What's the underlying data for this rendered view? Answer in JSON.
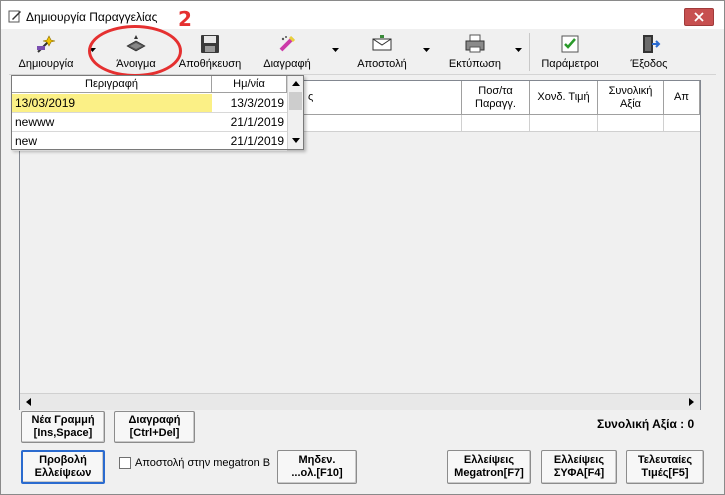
{
  "window": {
    "title": "Δημιουργία Παραγγελίας",
    "annotation_number": "2",
    "annotation_color": "#e53030"
  },
  "toolbar": {
    "create_label": "Δημιουργία",
    "open_label": "Άνοιγμα",
    "save_label": "Αποθήκευση",
    "delete_label": "Διαγραφή",
    "send_label": "Αποστολή",
    "print_label": "Εκτύπωση",
    "params_label": "Παράμετροι",
    "exit_label": "Έξοδος"
  },
  "grid": {
    "columns": [
      "ς",
      "Ποσ/τα Παραγγ.",
      "Χονδ. Τιμή",
      "Συνολική Αξία",
      "Απ"
    ]
  },
  "dropdown": {
    "headers": [
      "Περιγραφή",
      "Ημ/νία"
    ],
    "rows": [
      {
        "description": "13/03/2019",
        "date": "13/3/2019",
        "selected": true
      },
      {
        "description": "newww",
        "date": "21/1/2019",
        "selected": false
      },
      {
        "description": "new",
        "date": "21/1/2019",
        "selected": false
      }
    ],
    "highlight_color": "#fbf086"
  },
  "footer": {
    "new_line_label": "Νέα Γραμμή",
    "new_line_shortcut": "[Ins,Space]",
    "delete_line_label": "Διαγραφή",
    "delete_line_shortcut": "[Ctrl+Del]",
    "total_label": "Συνολική Αξία : 0",
    "show_shortages_label_1": "Προβολή",
    "show_shortages_label_2": "Ελλείψεων",
    "send_megatron_checkbox": "Αποστολή στην megatron B",
    "zero_label_1": "Μηδεν.",
    "zero_label_2": "...ολ.[F10]",
    "megatron_shortages_1": "Ελλείψεις",
    "megatron_shortages_2": "Megatron[F7]",
    "syfa_shortages_1": "Ελλείψεις",
    "syfa_shortages_2": "ΣΥΦΑ[F4]",
    "last_prices_1": "Τελευταίες",
    "last_prices_2": "Τιμές[F5]"
  }
}
